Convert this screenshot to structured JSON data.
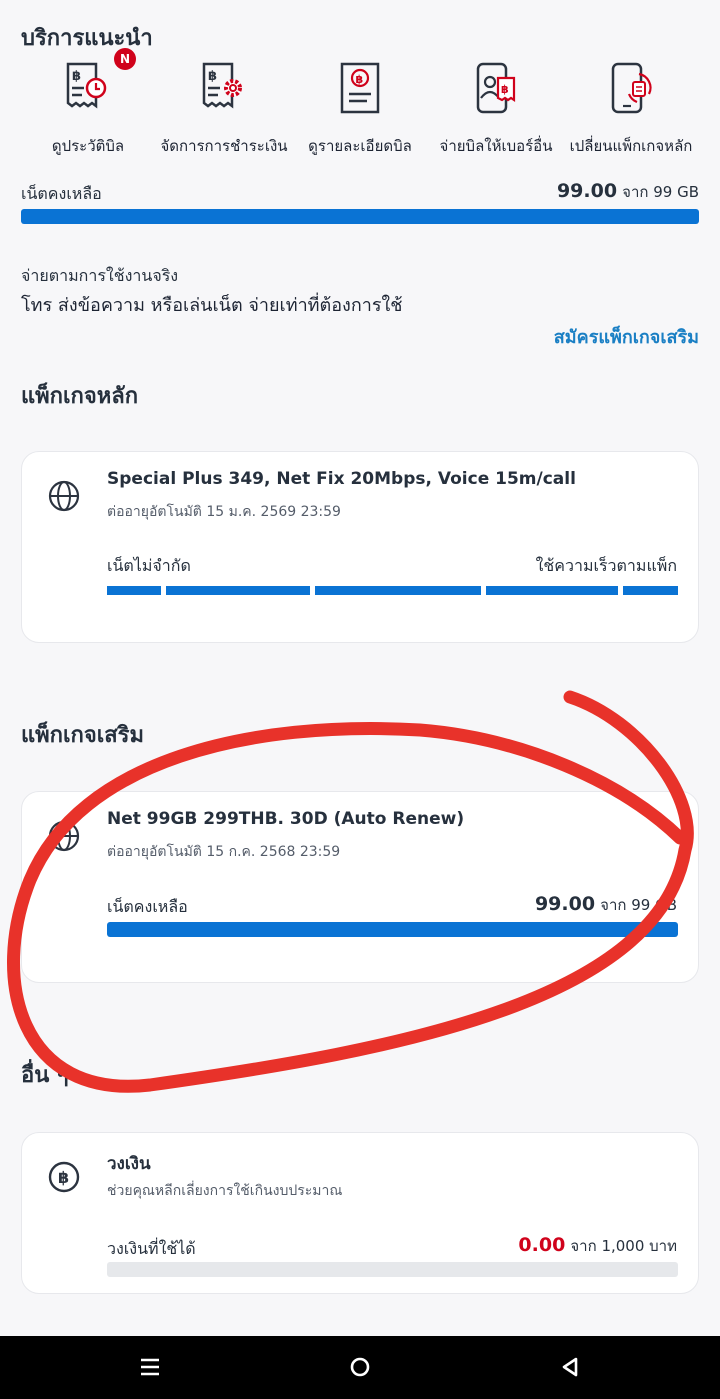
{
  "services": {
    "title": "บริการแนะนำ",
    "items": [
      {
        "label": "ดูประวัติบิล",
        "icon": "bill-history-icon",
        "badge": "N"
      },
      {
        "label": "จัดการการชำระเงิน",
        "icon": "payment-settings-icon"
      },
      {
        "label": "ดูรายละเอียดบิล",
        "icon": "bill-detail-icon"
      },
      {
        "label": "จ่ายบิลให้เบอร์อื่น",
        "icon": "pay-other-number-icon"
      },
      {
        "label": "เปลี่ยนแพ็กเกจหลัก",
        "icon": "change-main-package-icon"
      }
    ]
  },
  "net_remaining": {
    "label": "เน็ตคงเหลือ",
    "amount": "99.00",
    "of_text": "จาก 99 GB",
    "fraction": 1.0
  },
  "payg": {
    "title": "จ่ายตามการใช้งานจริง",
    "description": "โทร ส่งข้อความ หรือเล่นเน็ต จ่ายเท่าที่ต้องการใช้",
    "link": "สมัครแพ็กเกจเสริม"
  },
  "main_package": {
    "section_title": "แพ็กเกจหลัก",
    "name": "Special Plus 349, Net Fix 20Mbps, Voice 15m/call",
    "renew": "ต่ออายุอัตโนมัติ 15 ม.ค. 2569 23:59",
    "left_label": "เน็ตไม่จำกัด",
    "right_label": "ใช้ความเร็วตามแพ็ก"
  },
  "addon_package": {
    "section_title": "แพ็กเกจเสริม",
    "name": "Net 99GB 299THB. 30D (Auto Renew)",
    "renew": "ต่ออายุอัตโนมัติ 15 ก.ค. 2568 23:59",
    "label": "เน็ตคงเหลือ",
    "amount": "99.00",
    "of_text": "จาก 99 GB",
    "fraction": 1.0
  },
  "others": {
    "section_title": "อื่น ๆ",
    "credit": {
      "title": "วงเงิน",
      "subtitle": "ช่วยคุณหลีกเลี่ยงการใช้เกินงบประมาณ",
      "label": "วงเงินที่ใช้ได้",
      "amount": "0.00",
      "of_text": "จาก 1,000 บาท",
      "fraction": 0.0
    }
  },
  "colors": {
    "accent_blue": "#0a73d4",
    "link_blue": "#1a7fc4",
    "alert_red": "#d0021b",
    "annotation_red": "#e8322a"
  },
  "nav": {
    "menu_icon": "menu-icon",
    "home_icon": "home-icon",
    "back_icon": "back-icon"
  }
}
